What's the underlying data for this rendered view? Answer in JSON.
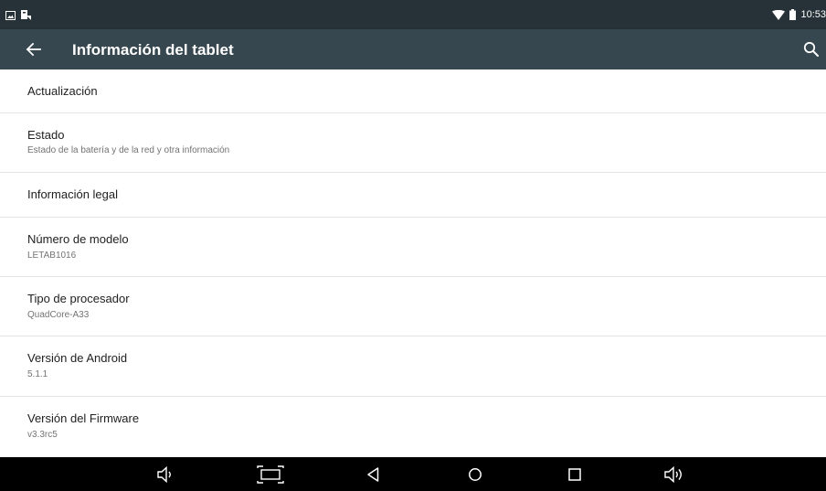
{
  "status_bar": {
    "time": "10:53",
    "left_icons": [
      "image-notification-icon",
      "download-notification-icon"
    ],
    "right_icons": [
      "wifi-icon",
      "battery-icon"
    ]
  },
  "app_bar": {
    "title": "Información del tablet",
    "back_icon": "arrow-back-icon",
    "search_icon": "search-icon"
  },
  "list": {
    "items": [
      {
        "title": "Actualización",
        "subtitle": ""
      },
      {
        "title": "Estado",
        "subtitle": "Estado de la batería y de la red y otra información"
      },
      {
        "title": "Información legal",
        "subtitle": ""
      },
      {
        "title": "Número de modelo",
        "subtitle": "LETAB1016"
      },
      {
        "title": "Tipo de procesador",
        "subtitle": "QuadCore-A33"
      },
      {
        "title": "Versión de Android",
        "subtitle": "5.1.1"
      },
      {
        "title": "Versión del Firmware",
        "subtitle": "v3.3rc5"
      }
    ]
  },
  "nav_bar": {
    "buttons": [
      "volume-down-icon",
      "screenshot-icon",
      "back-triangle-icon",
      "home-circle-icon",
      "recents-square-icon",
      "volume-up-icon"
    ]
  },
  "colors": {
    "status_bar": "#263238",
    "app_bar": "#37474f",
    "nav_bar": "#000000",
    "divider": "#e3e3e3",
    "primary_text": "#212121",
    "secondary_text": "#737373"
  }
}
